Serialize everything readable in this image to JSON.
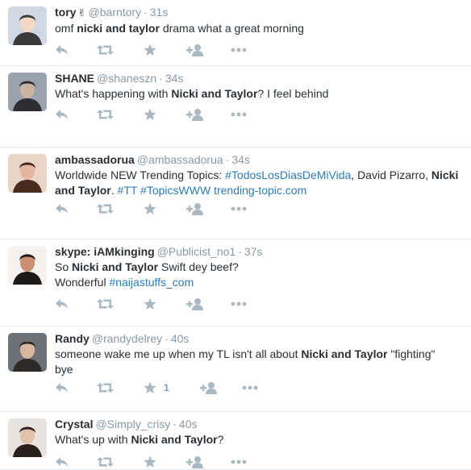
{
  "tweets": [
    {
      "name": "tory",
      "emoji": "✌︎",
      "handle": "@barntory",
      "time": "31s",
      "text_parts": [
        {
          "t": "omf ",
          "s": "plain"
        },
        {
          "t": "nicki and taylor",
          "s": "bold"
        },
        {
          "t": " drama what a great morning",
          "s": "plain"
        }
      ],
      "avatar": {
        "bg": "#cfd8e3",
        "fg": "#f2d9c6",
        "accent": "#3a3a3a"
      }
    },
    {
      "name": "SHANE",
      "handle": "@shaneszn",
      "time": "34s",
      "text_parts": [
        {
          "t": "What's happening with ",
          "s": "plain"
        },
        {
          "t": "Nicki and Taylor",
          "s": "bold"
        },
        {
          "t": "? I feel behind",
          "s": "plain"
        }
      ],
      "avatar": {
        "bg": "#9aa3ad",
        "fg": "#c9b3a4",
        "accent": "#2b2f33"
      }
    },
    {
      "name": "ambassadorua",
      "handle": "@ambassadorua",
      "time": "34s",
      "text_parts": [
        {
          "t": "Worldwide NEW Trending Topics: ",
          "s": "plain"
        },
        {
          "t": "#TodosLosDiasDeMiVida",
          "s": "link"
        },
        {
          "t": ", David Pizarro, ",
          "s": "plain"
        },
        {
          "t": "Nicki and Taylor",
          "s": "bold"
        },
        {
          "t": ". ",
          "s": "plain"
        },
        {
          "t": "#TT",
          "s": "link"
        },
        {
          "t": " ",
          "s": "plain"
        },
        {
          "t": "#TopicsWWW",
          "s": "link"
        },
        {
          "t": " ",
          "s": "plain"
        },
        {
          "t": "trending-topic.com",
          "s": "link"
        }
      ],
      "avatar": {
        "bg": "#e9d4c8",
        "fg": "#e6b79f",
        "accent": "#4a2a1e"
      }
    },
    {
      "name": "skype: iAMkinging",
      "handle": "@Publicist_no1",
      "time": "37s",
      "text_parts": [
        {
          "t": "So ",
          "s": "plain"
        },
        {
          "t": "Nicki and Taylor",
          "s": "bold"
        },
        {
          "t": " Swift dey beef?",
          "s": "plain"
        },
        {
          "t": "\n",
          "s": "break"
        },
        {
          "t": "Wonderful ",
          "s": "plain"
        },
        {
          "t": "#naijastuffs_com",
          "s": "link"
        }
      ],
      "avatar": {
        "bg": "#f4f1ee",
        "fg": "#c98f6e",
        "accent": "#1f1a17"
      }
    },
    {
      "name": "Randy",
      "handle": "@randydelrey",
      "time": "40s",
      "text_parts": [
        {
          "t": "someone wake me up when my TL isn't all about ",
          "s": "plain"
        },
        {
          "t": "Nicki and Taylor",
          "s": "bold"
        },
        {
          "t": " \"fighting\"",
          "s": "plain"
        },
        {
          "t": "\n",
          "s": "break"
        },
        {
          "t": "bye",
          "s": "plain"
        }
      ],
      "avatar": {
        "bg": "#6d7278",
        "fg": "#d8b6a0",
        "accent": "#2d2a28"
      },
      "favorite_count": "1"
    },
    {
      "name": "Crystal",
      "handle": "@Simply_crisy",
      "time": "40s",
      "text_parts": [
        {
          "t": "What's up with ",
          "s": "plain"
        },
        {
          "t": "Nicki and Taylor",
          "s": "bold"
        },
        {
          "t": "?",
          "s": "plain"
        }
      ],
      "avatar": {
        "bg": "#e8e3df",
        "fg": "#e2c0aa",
        "accent": "#2a1f1a"
      }
    }
  ],
  "icons": {
    "reply": "reply-icon",
    "retweet": "retweet-icon",
    "favorite": "favorite-icon",
    "follow": "follow-icon",
    "more": "more-icon"
  },
  "colors": {
    "text": "#292f33",
    "muted": "#8899a6",
    "icon": "#aab8c2",
    "link": "#2b7bb9",
    "divider": "#e1e8ed"
  }
}
